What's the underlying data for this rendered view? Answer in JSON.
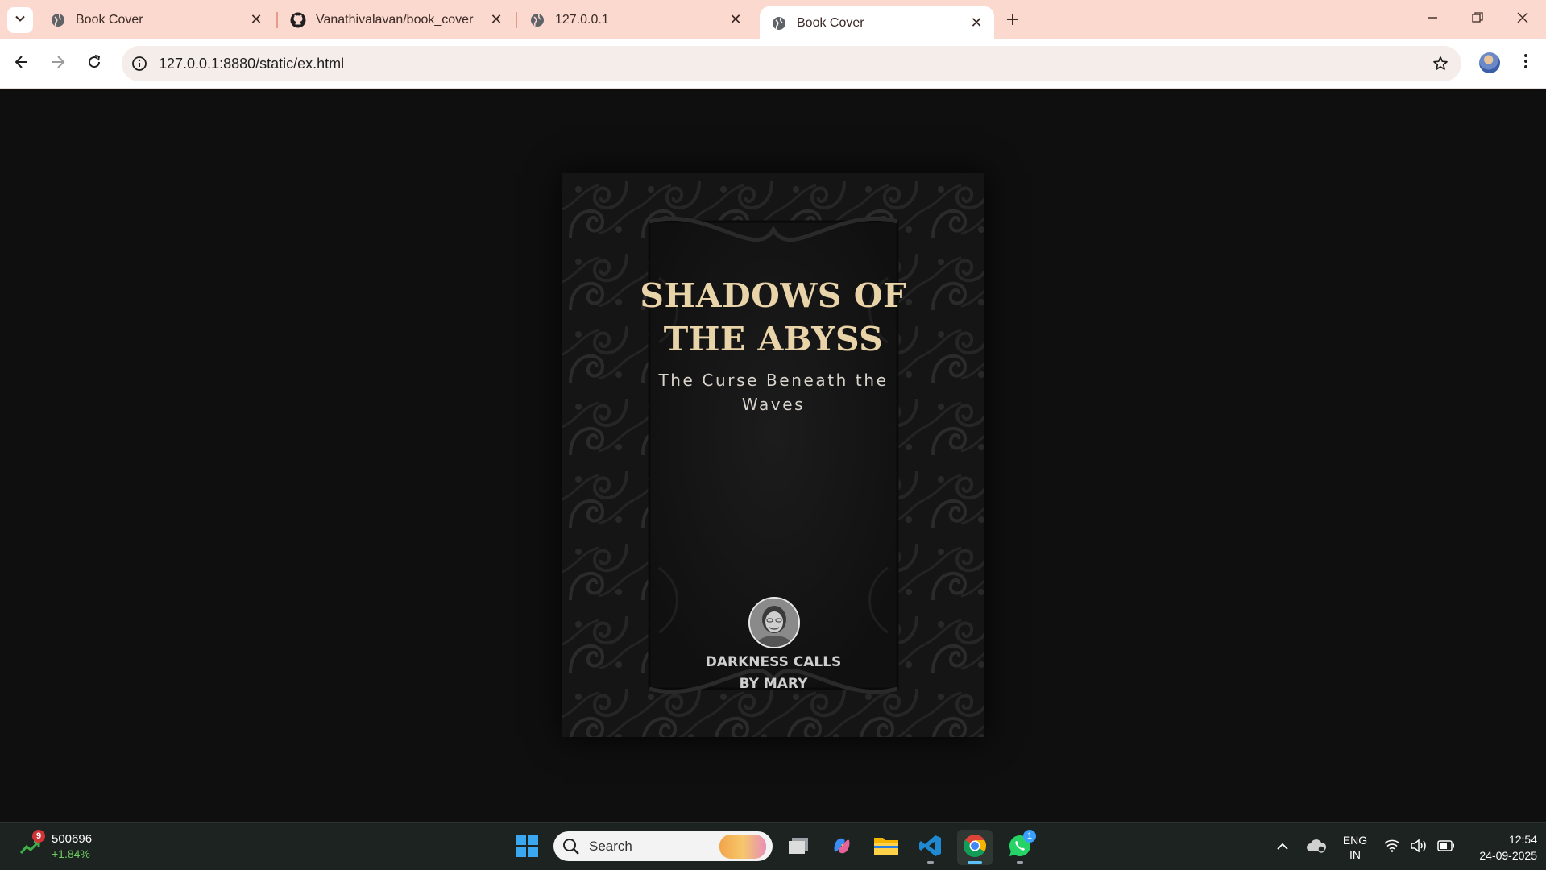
{
  "browser": {
    "tabs": [
      {
        "title": "Book Cover",
        "icon": "globe-icon",
        "active": false
      },
      {
        "title": "Vanathivalavan/book_cover",
        "icon": "github-icon",
        "active": false
      },
      {
        "title": "127.0.0.1",
        "icon": "globe-icon",
        "active": false
      },
      {
        "title": "Book Cover",
        "icon": "globe-icon",
        "active": true
      }
    ],
    "url": "127.0.0.1:8880/static/ex.html",
    "accent": "#fbd9cf"
  },
  "cover": {
    "title_line1": "SHADOWS OF",
    "title_line2": "THE ABYSS",
    "subtitle_line1": "The Curse Beneath the",
    "subtitle_line2": "Waves",
    "tagline_line1": "DARKNESS CALLS",
    "tagline_line2": "BY MARY",
    "title_color": "#e9d3a8"
  },
  "taskbar": {
    "stock_badge": "9",
    "stock_value": "500696",
    "stock_change": "+1.84%",
    "search_placeholder": "Search",
    "whatsapp_badge": "1",
    "language_line1": "ENG",
    "language_line2": "IN",
    "time": "12:54",
    "date": "24-09-2025"
  }
}
